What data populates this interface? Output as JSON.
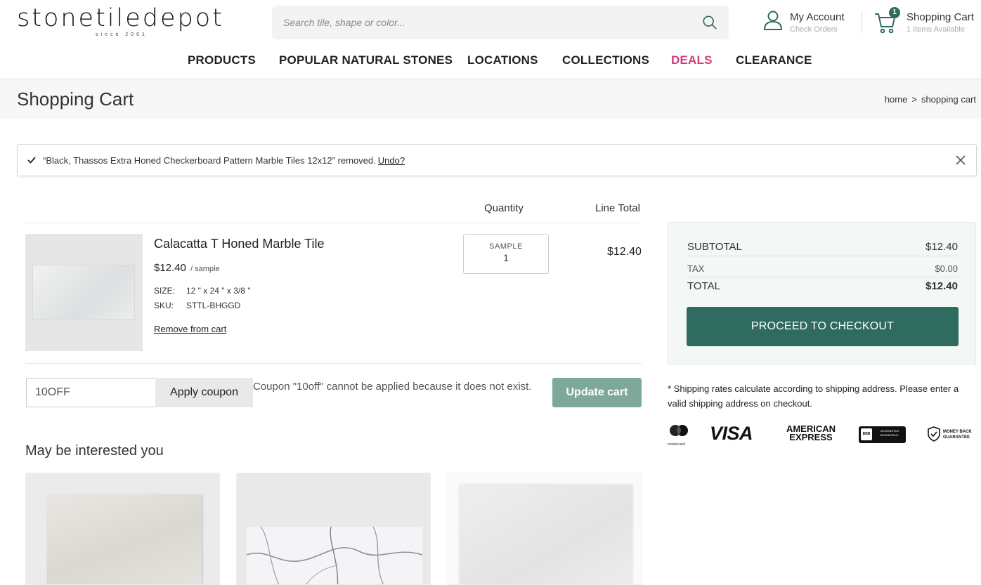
{
  "header": {
    "logo_text": "stonetiledepot",
    "logo_sub": "since 2001",
    "search_placeholder": "Search tile, shape or color...",
    "account_title": "My Account",
    "account_sub": "Check Orders",
    "cart_title": "Shopping Cart",
    "cart_sub": "1 Items Available",
    "cart_count": "1"
  },
  "nav": {
    "items": [
      "PRODUCTS",
      "POPULAR NATURAL STONES",
      "LOCATIONS",
      "COLLECTIONS",
      "DEALS",
      "CLEARANCE"
    ]
  },
  "page": {
    "title": "Shopping Cart",
    "breadcrumb": [
      "home",
      ">",
      "shopping cart"
    ]
  },
  "notice": {
    "message": "“Black, Thassos Extra Honed Checkerboard Pattern Marble Tiles 12x12” removed.",
    "undo_label": "Undo?"
  },
  "table": {
    "col_quantity": "Quantity",
    "col_line_total": "Line Total"
  },
  "item": {
    "name": "Calacatta T Honed Marble Tile",
    "price": "$12.40",
    "price_unit": "/ sample",
    "size_label": "SIZE:",
    "size_value": "12 \" x 24 \" x 3/8 \"",
    "sku_label": "SKU:",
    "sku_value": "STTL-BHGGD",
    "remove_label": "Remove from cart",
    "qty_label": "SAMPLE",
    "qty_value": "1",
    "line_total": "$12.40"
  },
  "coupon": {
    "value": "10OFF",
    "apply_label": "Apply coupon",
    "message": "Coupon \"10off\" cannot be applied because it does not exist.",
    "update_label": "Update cart"
  },
  "interest": {
    "title": "May be interested you"
  },
  "summary": {
    "subtotal_label": "SUBTOTAL",
    "subtotal_value": "$12.40",
    "tax_label": "TAX",
    "tax_value": "$0.00",
    "total_label": "TOTAL",
    "total_value": "$12.40",
    "checkout_label": "PROCEED TO CHECKOUT",
    "shipping_note": "* Shipping rates calculate according to shipping address. Please enter a valid shipping address on checkout."
  },
  "payment": {
    "mastercard": "mastercard",
    "visa": "VISA",
    "amex_line1": "AMERICAN",
    "amex_line2": "EXPRESS",
    "bbb_text": "ACCREDITED BUSINESS A+",
    "bbb_logo": "BBB",
    "money_back_line1": "MONEY BACK",
    "money_back_line2": "GUARANTEE"
  },
  "colors": {
    "brand_green": "#2f6b5e",
    "update_button": "#7fa89d",
    "deals_pink": "#d63a79"
  }
}
